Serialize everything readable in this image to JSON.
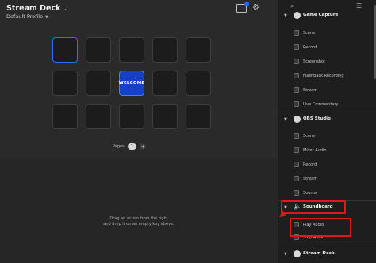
{
  "app": {
    "title": "Stream Deck",
    "profile": "Default Profile"
  },
  "grid": {
    "keys": [
      {
        "label": "",
        "selected": true
      },
      {
        "label": ""
      },
      {
        "label": ""
      },
      {
        "label": ""
      },
      {
        "label": ""
      },
      {
        "label": ""
      },
      {
        "label": ""
      },
      {
        "label": "WELCOME",
        "highlight": true
      },
      {
        "label": ""
      },
      {
        "label": ""
      },
      {
        "label": ""
      },
      {
        "label": ""
      },
      {
        "label": ""
      },
      {
        "label": ""
      },
      {
        "label": ""
      }
    ]
  },
  "pages": {
    "label": "Pages",
    "current": "1",
    "add": "+"
  },
  "hint": {
    "line1": "Drag an action from the right",
    "line2": "and drop it on an empty key above."
  },
  "sidebar": {
    "groups": [
      {
        "name": "Game Capture",
        "items": [
          "Scene",
          "Record",
          "Screenshot",
          "Flashback Recording",
          "Stream",
          "Live Commentary"
        ]
      },
      {
        "name": "OBS Studio",
        "items": [
          "Scene",
          "Mixer Audio",
          "Record",
          "Stream",
          "Source"
        ]
      },
      {
        "name": "Soundboard",
        "items": [
          "Play Audio",
          "Stop Audio"
        ]
      },
      {
        "name": "Stream Deck",
        "items": []
      }
    ]
  },
  "colors": {
    "accent": "#2f6ff0",
    "welcome_key": "#1740c9",
    "annotation": "#e3161b"
  }
}
